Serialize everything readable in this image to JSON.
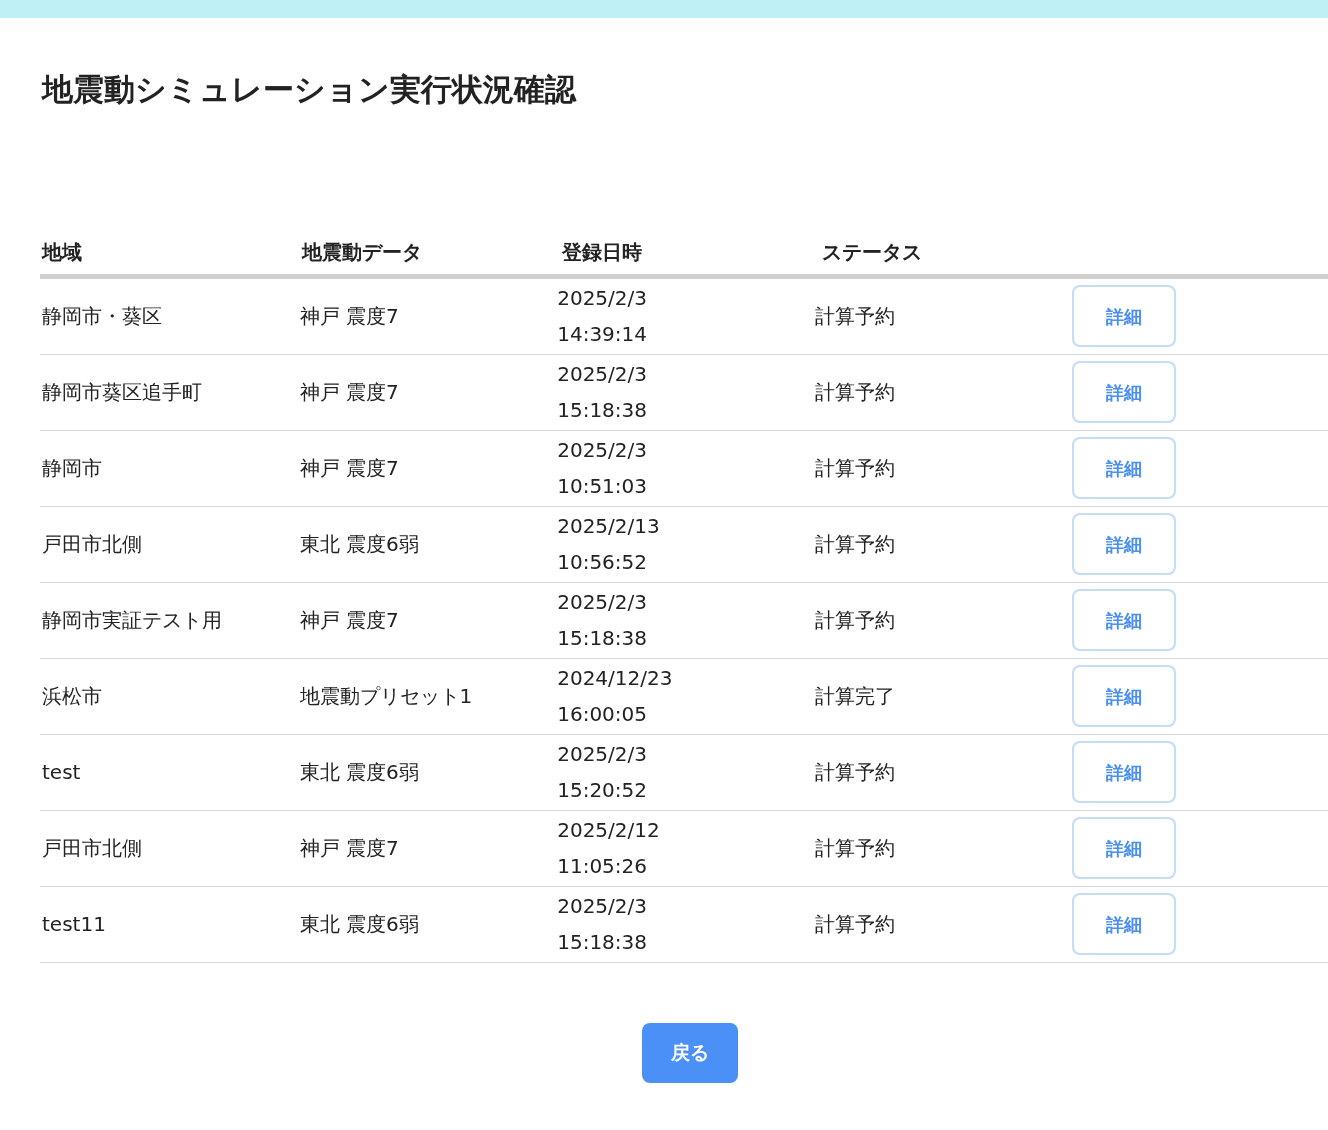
{
  "title": "地震動シミュレーション実行状況確認",
  "table": {
    "columns": [
      "地域",
      "地震動データ",
      "登録日時",
      "ステータス"
    ],
    "rows": [
      {
        "region": "静岡市・葵区",
        "motion": "神戸 震度7",
        "date": "2025/2/3",
        "time": "14:39:14",
        "status": "計算予約",
        "action": "詳細"
      },
      {
        "region": "静岡市葵区追手町",
        "motion": "神戸 震度7",
        "date": "2025/2/3",
        "time": "15:18:38",
        "status": "計算予約",
        "action": "詳細"
      },
      {
        "region": "静岡市",
        "motion": "神戸 震度7",
        "date": "2025/2/3",
        "time": "10:51:03",
        "status": "計算予約",
        "action": "詳細"
      },
      {
        "region": "戸田市北側",
        "motion": "東北 震度6弱",
        "date": "2025/2/13",
        "time": "10:56:52",
        "status": "計算予約",
        "action": "詳細"
      },
      {
        "region": "静岡市実証テスト用",
        "motion": "神戸 震度7",
        "date": "2025/2/3",
        "time": "15:18:38",
        "status": "計算予約",
        "action": "詳細"
      },
      {
        "region": "浜松市",
        "motion": "地震動プリセット1",
        "date": "2024/12/23",
        "time": "16:00:05",
        "status": "計算完了",
        "action": "詳細"
      },
      {
        "region": "test",
        "motion": "東北 震度6弱",
        "date": "2025/2/3",
        "time": "15:20:52",
        "status": "計算予約",
        "action": "詳細"
      },
      {
        "region": "戸田市北側",
        "motion": "神戸 震度7",
        "date": "2025/2/12",
        "time": "11:05:26",
        "status": "計算予約",
        "action": "詳細"
      },
      {
        "region": "test11",
        "motion": "東北 震度6弱",
        "date": "2025/2/3",
        "time": "15:18:38",
        "status": "計算予約",
        "action": "詳細"
      }
    ]
  },
  "back_button": "戻る"
}
